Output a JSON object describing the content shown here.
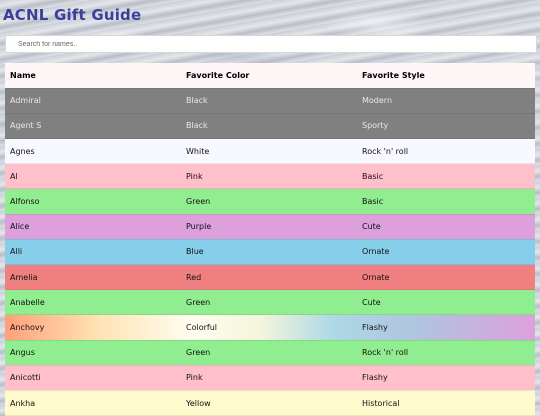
{
  "header": {
    "title": "ACNL Gift Guide"
  },
  "search": {
    "placeholder": "Search for names.."
  },
  "table": {
    "columns": [
      "Name",
      "Favorite Color",
      "Favorite Style"
    ],
    "rows": [
      {
        "name": "Admiral",
        "color": "Black",
        "style": "Modern",
        "bg": "#808080",
        "text": "light"
      },
      {
        "name": "Agent S",
        "color": "Black",
        "style": "Sporty",
        "bg": "#808080",
        "text": "light"
      },
      {
        "name": "Agnes",
        "color": "White",
        "style": "Rock 'n' roll",
        "bg": "#f8f8ff",
        "text": "dark"
      },
      {
        "name": "Al",
        "color": "Pink",
        "style": "Basic",
        "bg": "#ffc0cb",
        "text": "dark"
      },
      {
        "name": "Alfonso",
        "color": "Green",
        "style": "Basic",
        "bg": "#90ee90",
        "text": "dark"
      },
      {
        "name": "Alice",
        "color": "Purple",
        "style": "Cute",
        "bg": "#dda0dd",
        "text": "dark"
      },
      {
        "name": "Alli",
        "color": "Blue",
        "style": "Ornate",
        "bg": "#87ceeb",
        "text": "dark"
      },
      {
        "name": "Amelia",
        "color": "Red",
        "style": "Ornate",
        "bg": "#f08080",
        "text": "dark"
      },
      {
        "name": "Anabelle",
        "color": "Green",
        "style": "Cute",
        "bg": "#90ee90",
        "text": "dark"
      },
      {
        "name": "Anchovy",
        "color": "Colorful",
        "style": "Flashy",
        "bg": "rainbow",
        "text": "dark"
      },
      {
        "name": "Angus",
        "color": "Green",
        "style": "Rock 'n' roll",
        "bg": "#90ee90",
        "text": "dark"
      },
      {
        "name": "Anicotti",
        "color": "Pink",
        "style": "Flashy",
        "bg": "#ffc0cb",
        "text": "dark"
      },
      {
        "name": "Ankha",
        "color": "Yellow",
        "style": "Historical",
        "bg": "#fffacd",
        "text": "dark"
      }
    ]
  },
  "colors": {
    "title": "#3c3f9a",
    "rainbow": "linear-gradient(90deg, #ffa07a 0%, #ffe4b5 18%, #fffdf0 35%, #f5f5dc 48%, #add8e6 62%, #b0c4de 78%, #dda0dd 100%)"
  }
}
